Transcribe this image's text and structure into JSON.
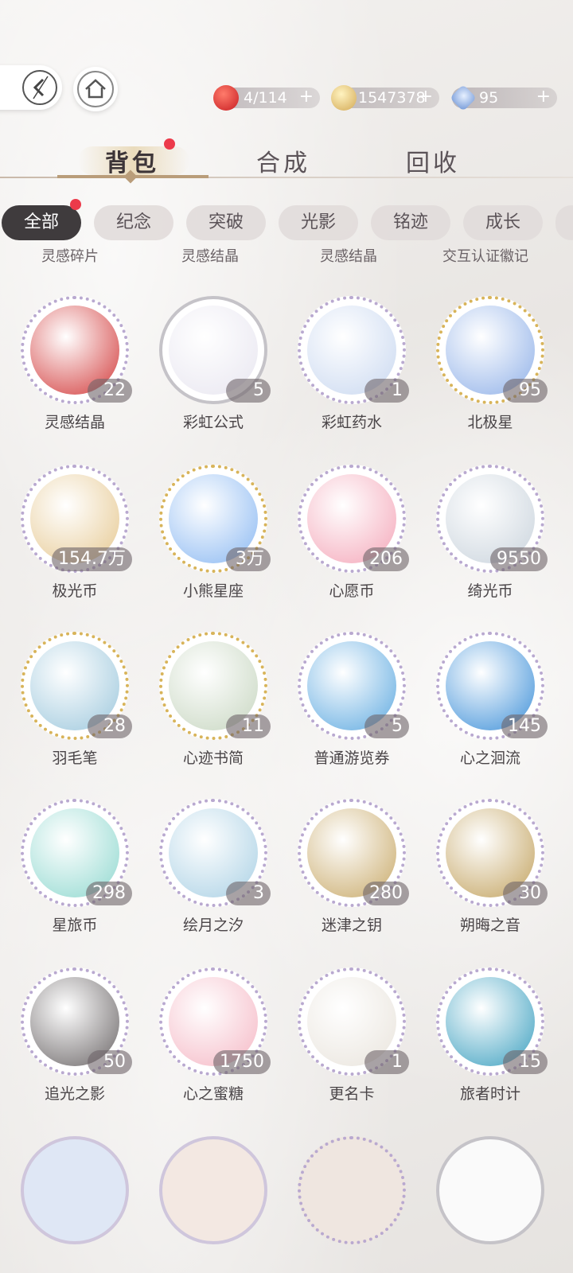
{
  "header": {
    "resources": [
      {
        "icon": "apple-icon",
        "value": "4/114",
        "color": "#d8262b"
      },
      {
        "icon": "coin-icon",
        "value": "1547378",
        "color": "#e7c16e"
      },
      {
        "icon": "crystal-icon",
        "value": "95",
        "color": "#7aa7e0"
      }
    ],
    "plus_label": "+"
  },
  "tabs": [
    {
      "label": "背包",
      "active": true
    },
    {
      "label": "合成",
      "active": false
    },
    {
      "label": "回收",
      "active": false
    }
  ],
  "filters": [
    "全部",
    "纪念",
    "突破",
    "光影",
    "铭迹",
    "成长"
  ],
  "partial_row": [
    "灵感碎片",
    "灵感结晶",
    "灵感结晶",
    "交互认证徽记"
  ],
  "items": [
    {
      "name": "灵感结晶",
      "count": "22",
      "ring": "lav",
      "art": "#d23a3a"
    },
    {
      "name": "彩虹公式",
      "count": "5",
      "ring": "silver",
      "art": "#e8e6f0"
    },
    {
      "name": "彩虹药水",
      "count": "1",
      "ring": "lav",
      "art": "#c9d8f0"
    },
    {
      "name": "北极星",
      "count": "95",
      "ring": "gold",
      "art": "#8fb0e8"
    },
    {
      "name": "极光币",
      "count": "154.7万",
      "ring": "lav",
      "art": "#e6c890"
    },
    {
      "name": "小熊星座",
      "count": "3万",
      "ring": "gold",
      "art": "#8ab8f2"
    },
    {
      "name": "心愿币",
      "count": "206",
      "ring": "lav",
      "art": "#f4a6b8"
    },
    {
      "name": "绮光币",
      "count": "9550",
      "ring": "lav",
      "art": "#c9d3dc"
    },
    {
      "name": "羽毛笔",
      "count": "28",
      "ring": "gold",
      "art": "#9cc7dc"
    },
    {
      "name": "心迹书简",
      "count": "11",
      "ring": "gold",
      "art": "#c7d6c0"
    },
    {
      "name": "普通游览券",
      "count": "5",
      "ring": "lav",
      "art": "#5da9e0"
    },
    {
      "name": "心之洄流",
      "count": "145",
      "ring": "lav",
      "art": "#3c8fd8"
    },
    {
      "name": "星旅币",
      "count": "298",
      "ring": "lav",
      "art": "#8fd8cf"
    },
    {
      "name": "绘月之汐",
      "count": "3",
      "ring": "lav",
      "art": "#a9d0e4"
    },
    {
      "name": "迷津之钥",
      "count": "280",
      "ring": "lav",
      "art": "#c8a968"
    },
    {
      "name": "朔晦之音",
      "count": "30",
      "ring": "lav",
      "art": "#c2a25e"
    },
    {
      "name": "追光之影",
      "count": "50",
      "ring": "lav",
      "art": "#6a6566"
    },
    {
      "name": "心之蜜糖",
      "count": "1750",
      "ring": "lav",
      "art": "#f5b7c4"
    },
    {
      "name": "更名卡",
      "count": "1",
      "ring": "lav",
      "art": "#e9e4dc"
    },
    {
      "name": "旅者时计",
      "count": "15",
      "ring": "lav",
      "art": "#3a9fbf"
    }
  ]
}
